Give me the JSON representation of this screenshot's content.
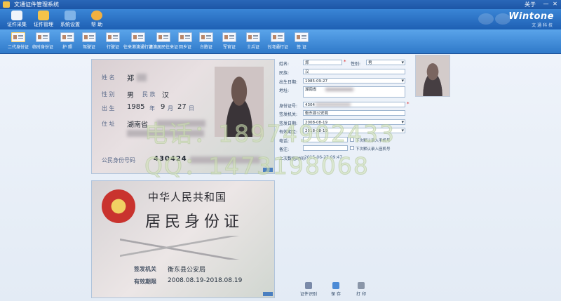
{
  "window": {
    "title": "文通证件管理系统",
    "about": "关于",
    "minimize": "—",
    "close": "✕"
  },
  "toolbar": [
    {
      "label": "证件采集",
      "icon": "scanner-icon",
      "color": "#f0f4fa"
    },
    {
      "label": "证件管理",
      "icon": "folder-icon",
      "color": "#f4c34a"
    },
    {
      "label": "系统设置",
      "icon": "home-settings-icon",
      "color": "#7fb3e8"
    },
    {
      "label": "帮 助",
      "icon": "help-user-icon",
      "color": "#f2b040"
    }
  ],
  "brand": {
    "name": "Wintone",
    "sub": "文 通 科 技"
  },
  "doc_types": [
    {
      "label": "二代身份证",
      "selected": true
    },
    {
      "label": "临时身份证",
      "selected": false
    },
    {
      "label": "护 照",
      "selected": false
    },
    {
      "label": "驾驶证",
      "selected": false
    },
    {
      "label": "行驶证",
      "selected": false
    },
    {
      "label": "往来港澳通行证",
      "selected": false
    },
    {
      "label": "港澳居民往来证",
      "selected": false
    },
    {
      "label": "回乡证",
      "selected": false
    },
    {
      "label": "台胞证",
      "selected": false
    },
    {
      "label": "军官证",
      "selected": false
    },
    {
      "label": "士兵证",
      "selected": false
    },
    {
      "label": "台湾通行证",
      "selected": false
    },
    {
      "label": "签 证",
      "selected": false
    }
  ],
  "front": {
    "name_label": "姓 名",
    "name_value": "郑",
    "gender_label": "性 别",
    "gender_value": "男",
    "ethnic_label": "民 族",
    "ethnic_value": "汉",
    "birth_label": "出 生",
    "birth_year": "1985",
    "year_unit": "年",
    "birth_month": "9",
    "month_unit": "月",
    "birth_day": "27",
    "day_unit": "日",
    "address_label": "住 址",
    "address_value": "湖南省",
    "id_label": "公民身份号码",
    "id_value": "430424"
  },
  "back": {
    "title1": "中华人民共和国",
    "title2": "居民身份证",
    "authority_label": "签发机关",
    "authority_value": "衡东县公安局",
    "validity_label": "有效期限",
    "validity_value": "2008.08.19-2018.08.19"
  },
  "watermark": {
    "line1": "电话：18974902433",
    "line2": "QQ：1473198068"
  },
  "form": {
    "name_label": "姓名:",
    "name_value": "郑",
    "gender_label": "性别:",
    "gender_value": "男",
    "ethnic_label": "民族:",
    "ethnic_value": "汉",
    "birth_label": "出生日期:",
    "birth_value": "1985-09-27",
    "address_label": "地址:",
    "address_value": "湖南省",
    "id_label": "身份证号:",
    "id_value": "4304",
    "authority_label": "签发机关:",
    "authority_value": "衡东县公安局",
    "issue_label": "签发日期:",
    "issue_value": "2008-08-19",
    "expire_label": "有效期至:",
    "expire_value": "2018-08-19",
    "phone_label": "电话:",
    "phone_value": "",
    "note_label": "备注:",
    "note_value": "",
    "chk1_label": "下次默认录入手机号",
    "chk2_label": "下次默认录入座机号",
    "time_label": "上次数据时间:",
    "time_value": "2015-06-27 09:47"
  },
  "actions": [
    {
      "label": "证件识别",
      "icon": "recognize-icon",
      "color": "#7a8aa8"
    },
    {
      "label": "保 存",
      "icon": "save-icon",
      "color": "#4c8bd6"
    },
    {
      "label": "打 印",
      "icon": "print-icon",
      "color": "#8a96a8"
    }
  ]
}
